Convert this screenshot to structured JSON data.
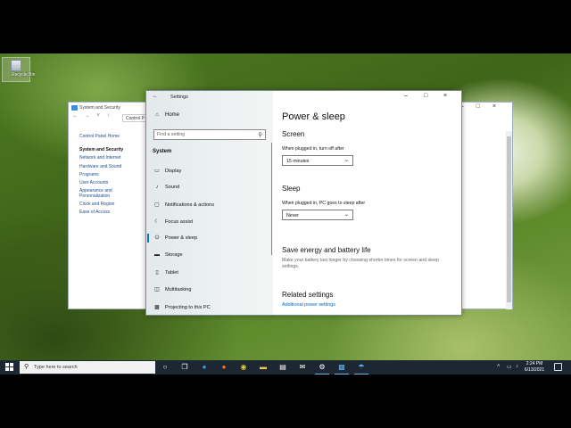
{
  "desktop": {
    "recycle_bin_label": "Recycle Bin"
  },
  "control_panel": {
    "title": "System and Security",
    "address": "Control P",
    "links": [
      {
        "label": "Control Panel Home"
      },
      {
        "label": "System and Security"
      },
      {
        "label": "Network and Internet"
      },
      {
        "label": "Hardware and Sound"
      },
      {
        "label": "Programs"
      },
      {
        "label": "User Accounts"
      },
      {
        "label": "Appearance and Personalization"
      },
      {
        "label": "Clock and Region"
      },
      {
        "label": "Ease of Access"
      }
    ]
  },
  "settings": {
    "title": "Settings",
    "home_label": "Home",
    "search_placeholder": "Find a setting",
    "section_label": "System",
    "nav": [
      {
        "label": "Display",
        "icon": "display-icon"
      },
      {
        "label": "Sound",
        "icon": "sound-icon"
      },
      {
        "label": "Notifications & actions",
        "icon": "notifications-icon"
      },
      {
        "label": "Focus assist",
        "icon": "focus-assist-icon"
      },
      {
        "label": "Power & sleep",
        "icon": "power-icon"
      },
      {
        "label": "Storage",
        "icon": "storage-icon"
      },
      {
        "label": "Tablet",
        "icon": "tablet-icon"
      },
      {
        "label": "Multitasking",
        "icon": "multitasking-icon"
      },
      {
        "label": "Projecting to this PC",
        "icon": "projecting-icon"
      }
    ],
    "active_nav": "Power & sleep",
    "page_title": "Power & sleep",
    "screen_heading": "Screen",
    "screen_label": "When plugged in, turn off after",
    "screen_value": "15 minutes",
    "sleep_heading": "Sleep",
    "sleep_label": "When plugged in, PC goes to sleep after",
    "sleep_value": "Never",
    "energy_heading": "Save energy and battery life",
    "energy_desc": "Make your battery last longer by choosing shorter times for screen and sleep settings.",
    "related_heading": "Related settings",
    "related_link": "Additional power settings"
  },
  "taskbar": {
    "search_placeholder": "Type here to search",
    "time": "2:24 PM",
    "date": "6/13/2021",
    "accent": "#0078d7"
  }
}
